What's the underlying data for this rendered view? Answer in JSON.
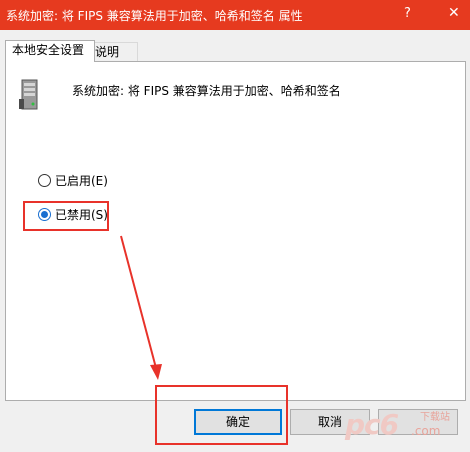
{
  "window": {
    "title": "系统加密: 将 FIPS 兼容算法用于加密、哈希和签名 属性",
    "help_label": "?",
    "close_label": "✕",
    "accent_color": "#e63a1f"
  },
  "tabs": [
    {
      "label": "本地安全设置",
      "active": true
    },
    {
      "label": "说明",
      "active": false
    }
  ],
  "policy": {
    "icon": "server-icon",
    "name": "系统加密: 将 FIPS 兼容算法用于加密、哈希和签名"
  },
  "options": [
    {
      "label": "已启用(E)",
      "selected": false
    },
    {
      "label": "已禁用(S)",
      "selected": true
    }
  ],
  "buttons": {
    "ok": "确定",
    "cancel": "取消"
  },
  "annotation": {
    "color": "#e8322a"
  },
  "watermark": {
    "logo": "pc6",
    "sub1": "下载站",
    "sub2": ".com"
  }
}
